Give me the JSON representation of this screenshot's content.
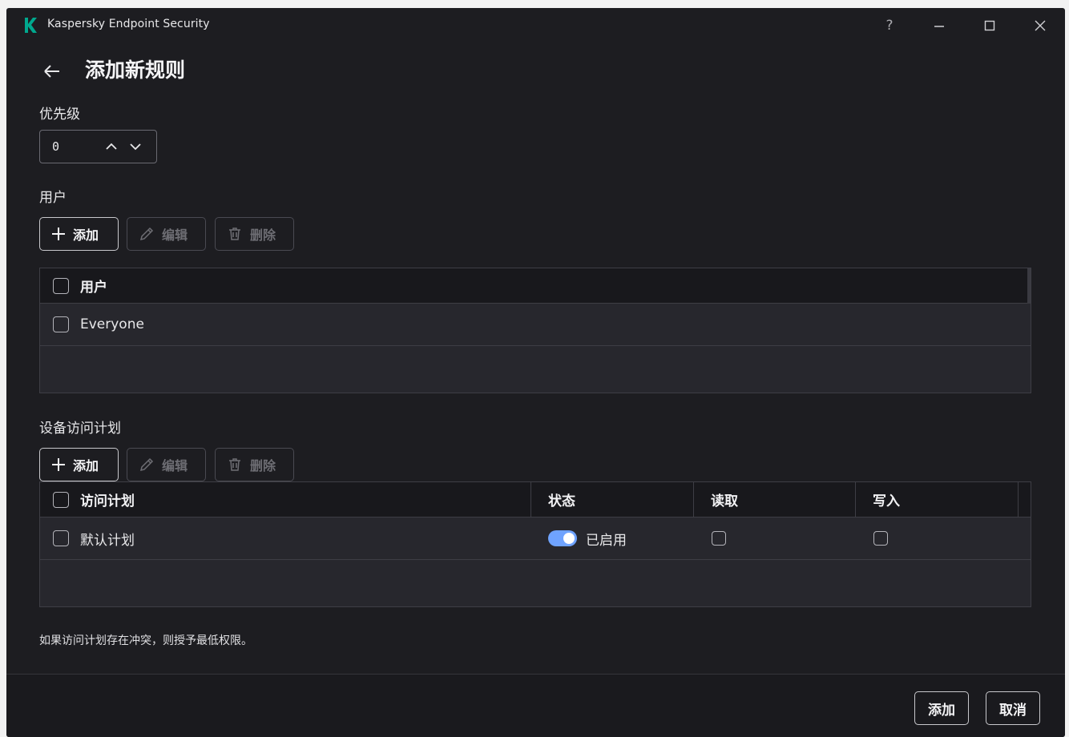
{
  "window": {
    "title": "Kaspersky Endpoint Security",
    "controls": {
      "help": "?",
      "minimize": "–",
      "maximize": "□",
      "close": "✕"
    }
  },
  "header": {
    "title": "添加新规则"
  },
  "priority": {
    "label": "优先级",
    "value": "0"
  },
  "users": {
    "label": "用户",
    "toolbar": {
      "add": "添加",
      "edit": "编辑",
      "delete": "删除"
    },
    "table": {
      "header": "用户",
      "rows": [
        {
          "name": "Everyone"
        }
      ]
    }
  },
  "schedules": {
    "label": "设备访问计划",
    "toolbar": {
      "add": "添加",
      "edit": "编辑",
      "delete": "删除"
    },
    "table": {
      "columns": [
        "访问计划",
        "状态",
        "读取",
        "写入"
      ],
      "rows": [
        {
          "name": "默认计划",
          "status": "已启用",
          "enabled": true,
          "read": false,
          "write": false
        }
      ]
    }
  },
  "note": "如果访问计划存在冲突，则授予最低权限。",
  "footer": {
    "add": "添加",
    "cancel": "取消"
  },
  "colors": {
    "background": "#1d1d21",
    "accent_toggle": "#6fa3ff",
    "logo_green": "#00a88e"
  }
}
